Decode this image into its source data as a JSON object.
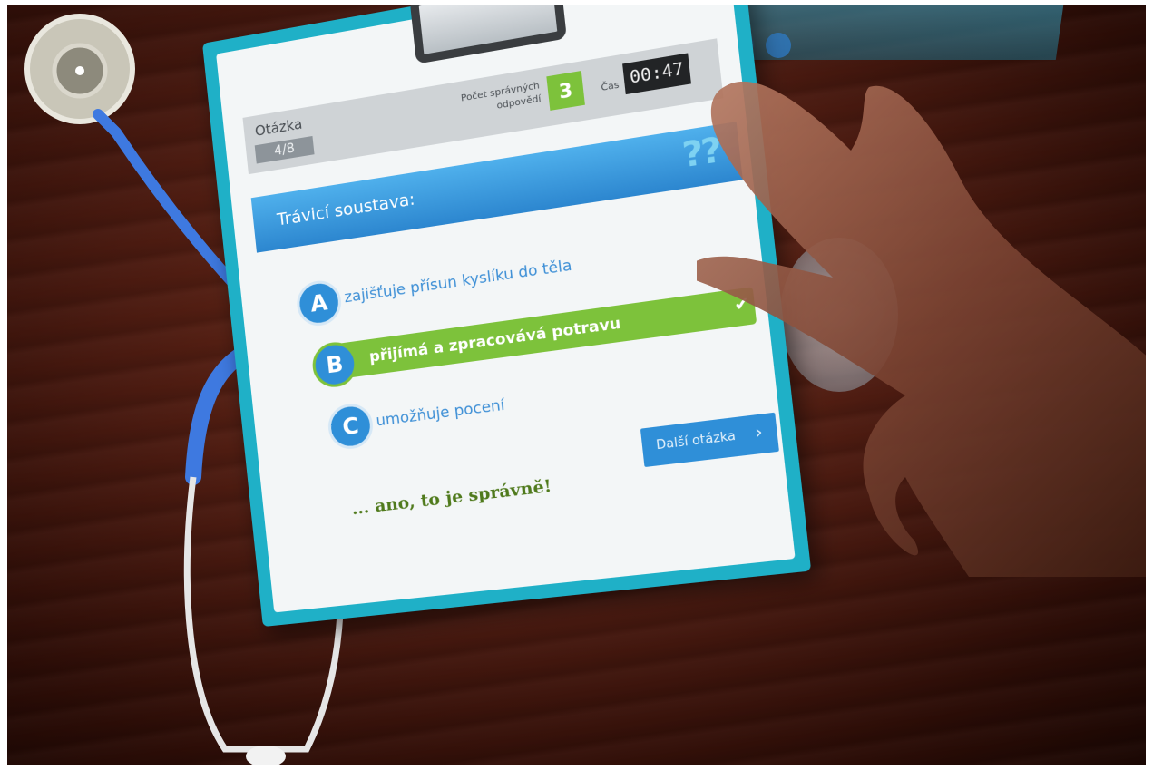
{
  "header": {
    "question_label": "Otázka",
    "question_progress": "4/8",
    "correct_count_label": "Počet správných odpovědí",
    "correct_count": "3",
    "time_label": "Čas",
    "time_value": "00:47"
  },
  "question": {
    "title": "Trávicí soustava:",
    "icon": "question-marks-icon"
  },
  "answers": [
    {
      "letter": "A",
      "text": "zajišťuje přísun kyslíku do těla",
      "selected": false
    },
    {
      "letter": "B",
      "text": "přijímá a zpracovává potravu",
      "selected": true,
      "correct": true
    },
    {
      "letter": "C",
      "text": "umožňuje pocení",
      "selected": false
    }
  ],
  "next_button": {
    "label": "Další otázka"
  },
  "feedback": "... ano, to je správně!",
  "colors": {
    "accent_blue": "#2f8fd8",
    "correct_green": "#7dc23b",
    "board_teal": "#1fb0c7"
  }
}
